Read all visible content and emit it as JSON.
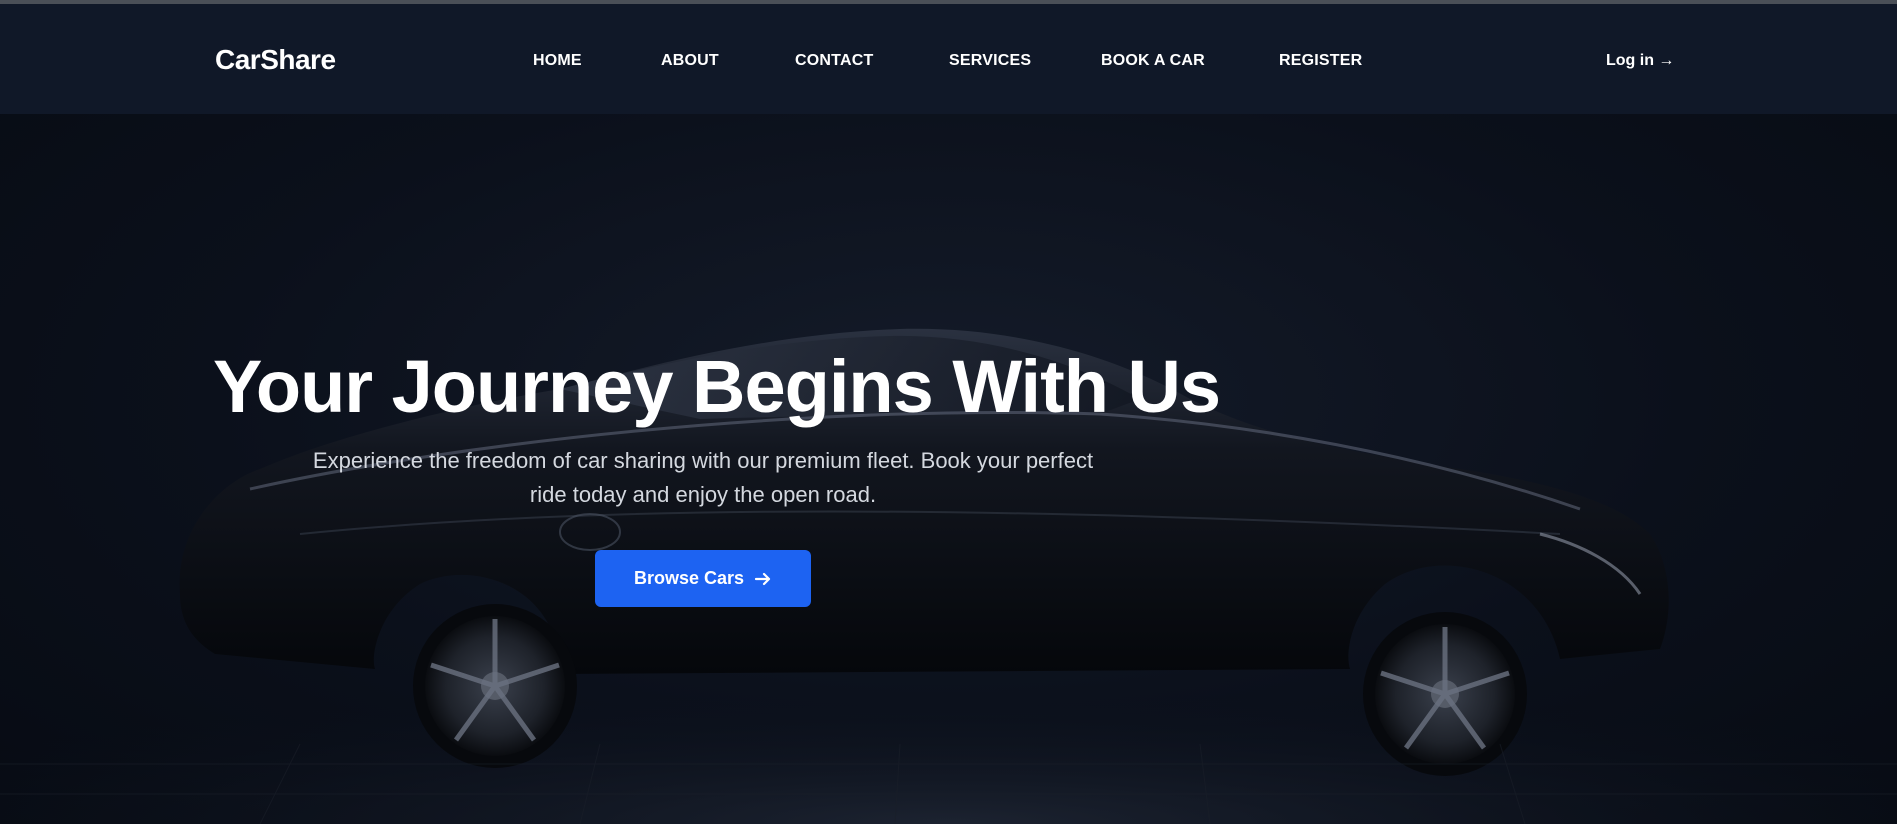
{
  "brand": {
    "name": "CarShare"
  },
  "nav": {
    "items": [
      {
        "label": "HOME"
      },
      {
        "label": "ABOUT"
      },
      {
        "label": "CONTACT"
      },
      {
        "label": "SERVICES"
      },
      {
        "label": "BOOK A CAR"
      },
      {
        "label": "REGISTER"
      }
    ],
    "login_label": "Log in →"
  },
  "hero": {
    "title": "Your Journey Begins With Us",
    "subtitle": "Experience the freedom of car sharing with our premium fleet. Book your perfect ride today and enjoy the open road.",
    "cta_label": "Browse Cars",
    "cta_icon": "arrow-right-icon"
  },
  "colors": {
    "navbar_bg": "#101828",
    "hero_bg": "#0b101b",
    "accent": "#1d63f2",
    "text": "#ffffff"
  }
}
